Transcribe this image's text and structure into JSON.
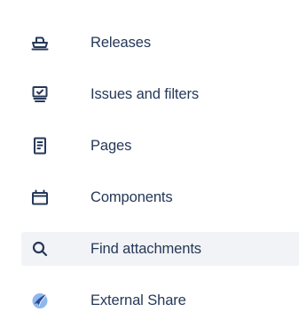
{
  "sidebar": {
    "items": [
      {
        "label": "Releases",
        "icon": "ship-icon"
      },
      {
        "label": "Issues and filters",
        "icon": "issues-filter-icon"
      },
      {
        "label": "Pages",
        "icon": "page-icon"
      },
      {
        "label": "Components",
        "icon": "components-icon"
      },
      {
        "label": "Find attachments",
        "icon": "search-icon",
        "highlighted": true
      },
      {
        "label": "External Share",
        "icon": "external-share-icon"
      }
    ]
  },
  "colors": {
    "text": "#253858",
    "highlight_bg": "#f2f3f6",
    "icon": "#253858",
    "external_share_dark": "#2c4a9a",
    "external_share_light": "#8fb8ea"
  }
}
